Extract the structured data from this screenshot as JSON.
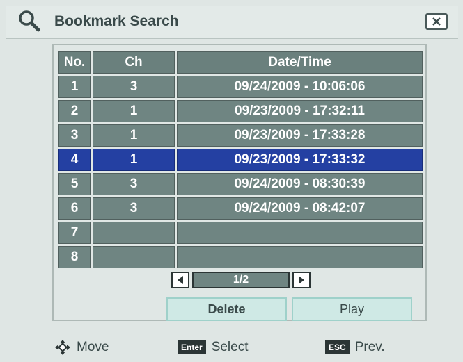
{
  "window": {
    "title": "Bookmark Search",
    "close_icon": "close-x-icon",
    "title_icon": "magnifier-icon"
  },
  "table": {
    "headers": [
      "No.",
      "Ch",
      "Date/Time"
    ],
    "rows": [
      {
        "no": "1",
        "ch": "3",
        "datetime": "09/24/2009 - 10:06:06"
      },
      {
        "no": "2",
        "ch": "1",
        "datetime": "09/23/2009 - 17:32:11"
      },
      {
        "no": "3",
        "ch": "1",
        "datetime": "09/23/2009 - 17:33:28"
      },
      {
        "no": "4",
        "ch": "1",
        "datetime": "09/23/2009 - 17:33:32"
      },
      {
        "no": "5",
        "ch": "3",
        "datetime": "09/24/2009 - 08:30:39"
      },
      {
        "no": "6",
        "ch": "3",
        "datetime": "09/24/2009 - 08:42:07"
      },
      {
        "no": "7",
        "ch": "",
        "datetime": ""
      },
      {
        "no": "8",
        "ch": "",
        "datetime": ""
      }
    ],
    "selected_row": "4"
  },
  "pager": {
    "label": "1/2",
    "prev_icon": "triangle-left-icon",
    "next_icon": "triangle-right-icon"
  },
  "buttons": {
    "delete": "Delete",
    "play": "Play"
  },
  "footer": {
    "move_label": "Move",
    "enter_key": "Enter",
    "select_label": "Select",
    "esc_key": "ESC",
    "prev_label": "Prev."
  },
  "colors": {
    "cell": "#6f8582",
    "selected": "#2440a2",
    "background": "#dfe6e4",
    "button": "#cfe9e5"
  }
}
